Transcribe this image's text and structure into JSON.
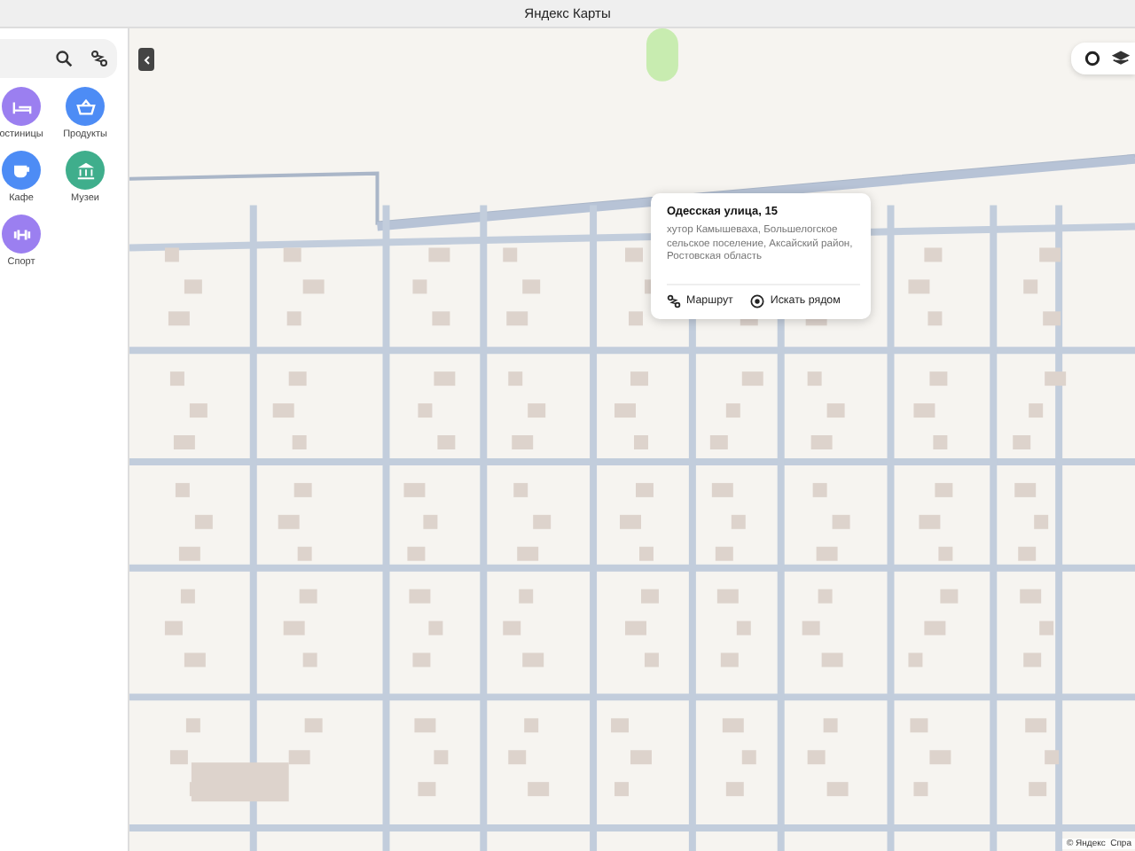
{
  "window": {
    "title": "Яндекс Карты"
  },
  "sidebar": {
    "categories": [
      {
        "label": "остиницы",
        "kind": "hotel",
        "color": "#9b7ff0"
      },
      {
        "label": "Продукты",
        "kind": "shop",
        "color": "#4d8cf5"
      },
      {
        "label": "Кафе",
        "kind": "cafe",
        "color": "#4d8cf5"
      },
      {
        "label": "Музеи",
        "kind": "museum",
        "color": "#3fae8c"
      },
      {
        "label": "Спорт",
        "kind": "sport",
        "color": "#9b7ff0"
      }
    ]
  },
  "popup": {
    "title": "Одесская улица, 15",
    "address": "хутор Камышеваха, Большелогское сельское поселение, Аксайский район, Ростовская область",
    "actions": [
      {
        "label": "Маршрут",
        "kind": "route"
      },
      {
        "label": "Искать рядом",
        "kind": "nearby"
      }
    ]
  },
  "attribution": "© Яндекс  Спра"
}
